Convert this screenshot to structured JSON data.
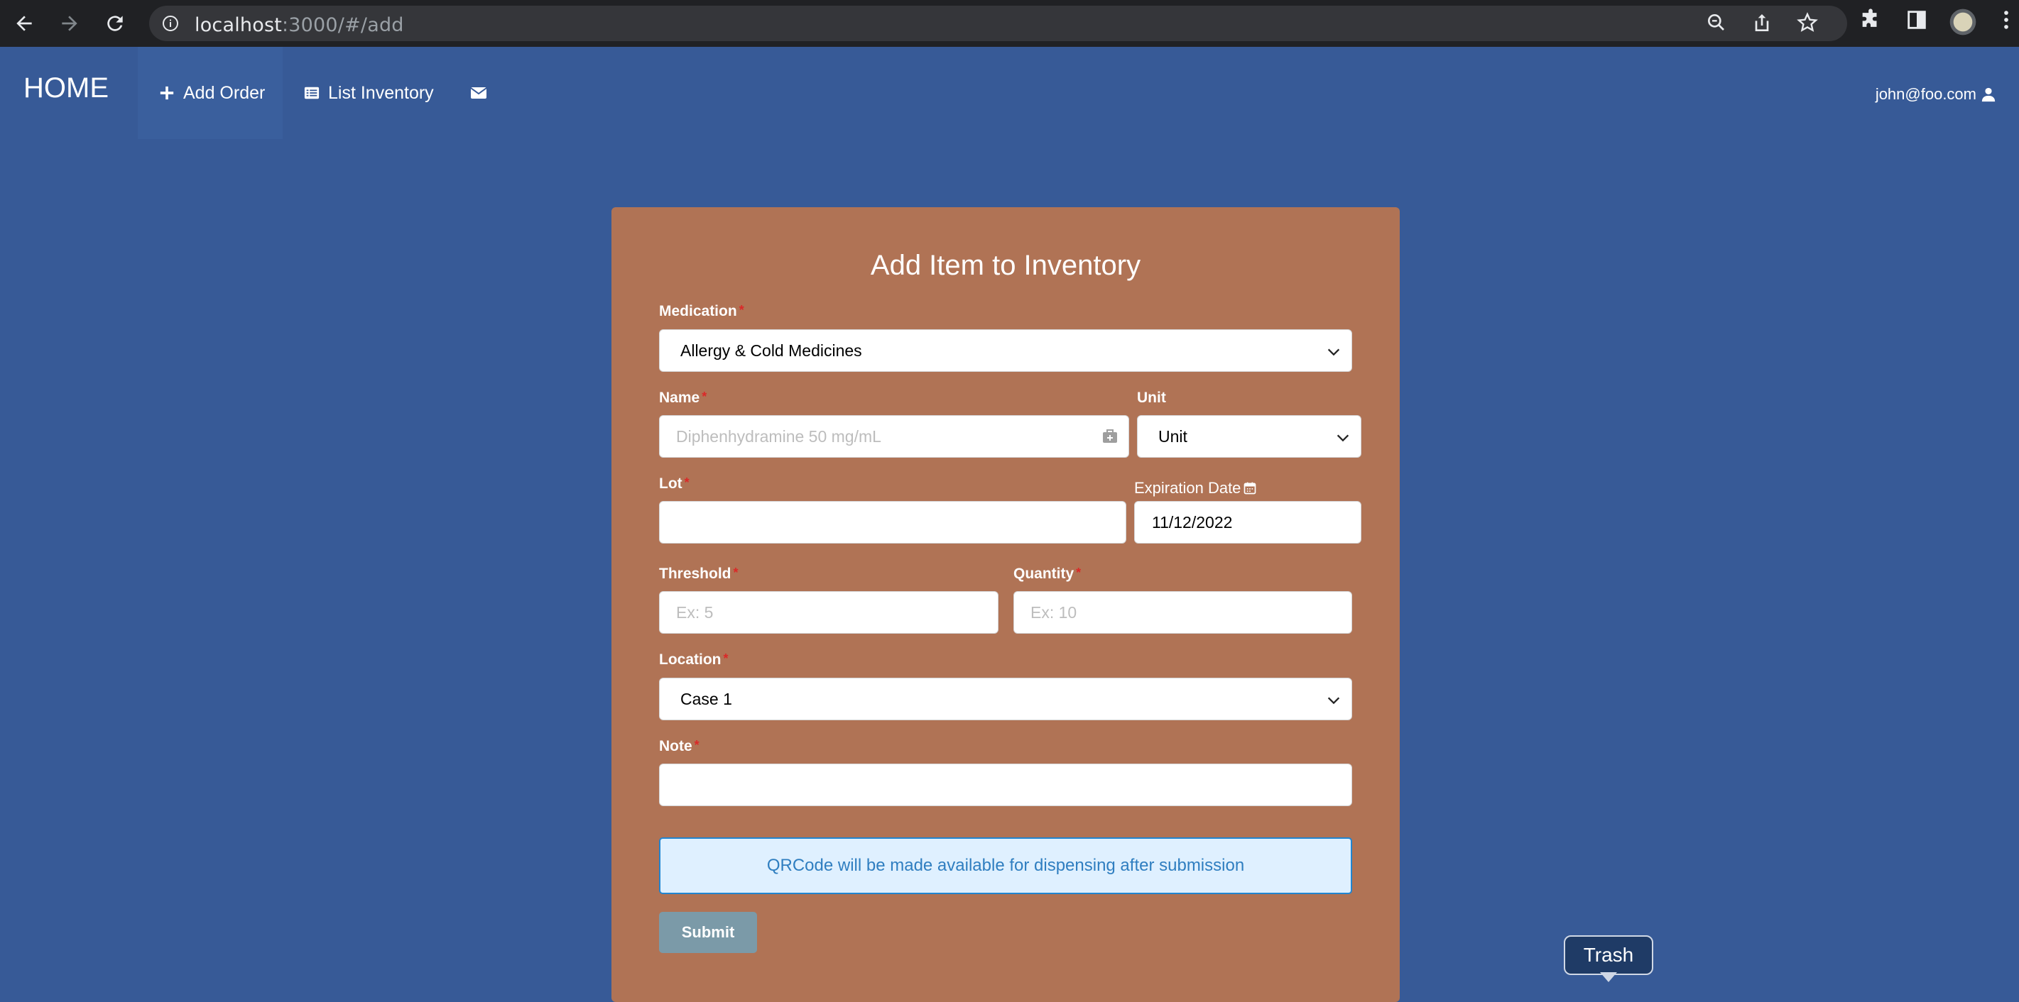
{
  "browser": {
    "url_host": "localhost",
    "url_rest": ":3000/#/add"
  },
  "navbar": {
    "brand": "HOME",
    "items": [
      {
        "label": "Add Order",
        "icon": "plus-icon"
      },
      {
        "label": "List Inventory",
        "icon": "list-icon"
      },
      {
        "label": "",
        "icon": "envelope-icon"
      }
    ],
    "user": "john@foo.com"
  },
  "form": {
    "title": "Add Item to Inventory",
    "medication": {
      "label": "Medication",
      "value": "Allergy & Cold Medicines"
    },
    "name": {
      "label": "Name",
      "placeholder": "Diphenhydramine 50 mg/mL"
    },
    "unit": {
      "label": "Unit",
      "value": "Unit"
    },
    "lot": {
      "label": "Lot",
      "value": ""
    },
    "expiration": {
      "label": "Expiration Date",
      "value": "11/12/2022"
    },
    "threshold": {
      "label": "Threshold",
      "placeholder": "Ex: 5"
    },
    "quantity": {
      "label": "Quantity",
      "placeholder": "Ex: 10"
    },
    "location": {
      "label": "Location",
      "value": "Case 1"
    },
    "note": {
      "label": "Note",
      "value": ""
    },
    "required_mark": "*",
    "info_message": "QRCode will be made available for dispensing after submission",
    "submit_label": "Submit"
  },
  "tooltip": {
    "label": "Trash"
  },
  "colors": {
    "page_bg": "#375a97",
    "card_bg": "#b07355",
    "chrome_bg": "#202124",
    "submit_bg": "#7b9aa8",
    "required": "#db2828",
    "info_border": "#2185d0"
  }
}
